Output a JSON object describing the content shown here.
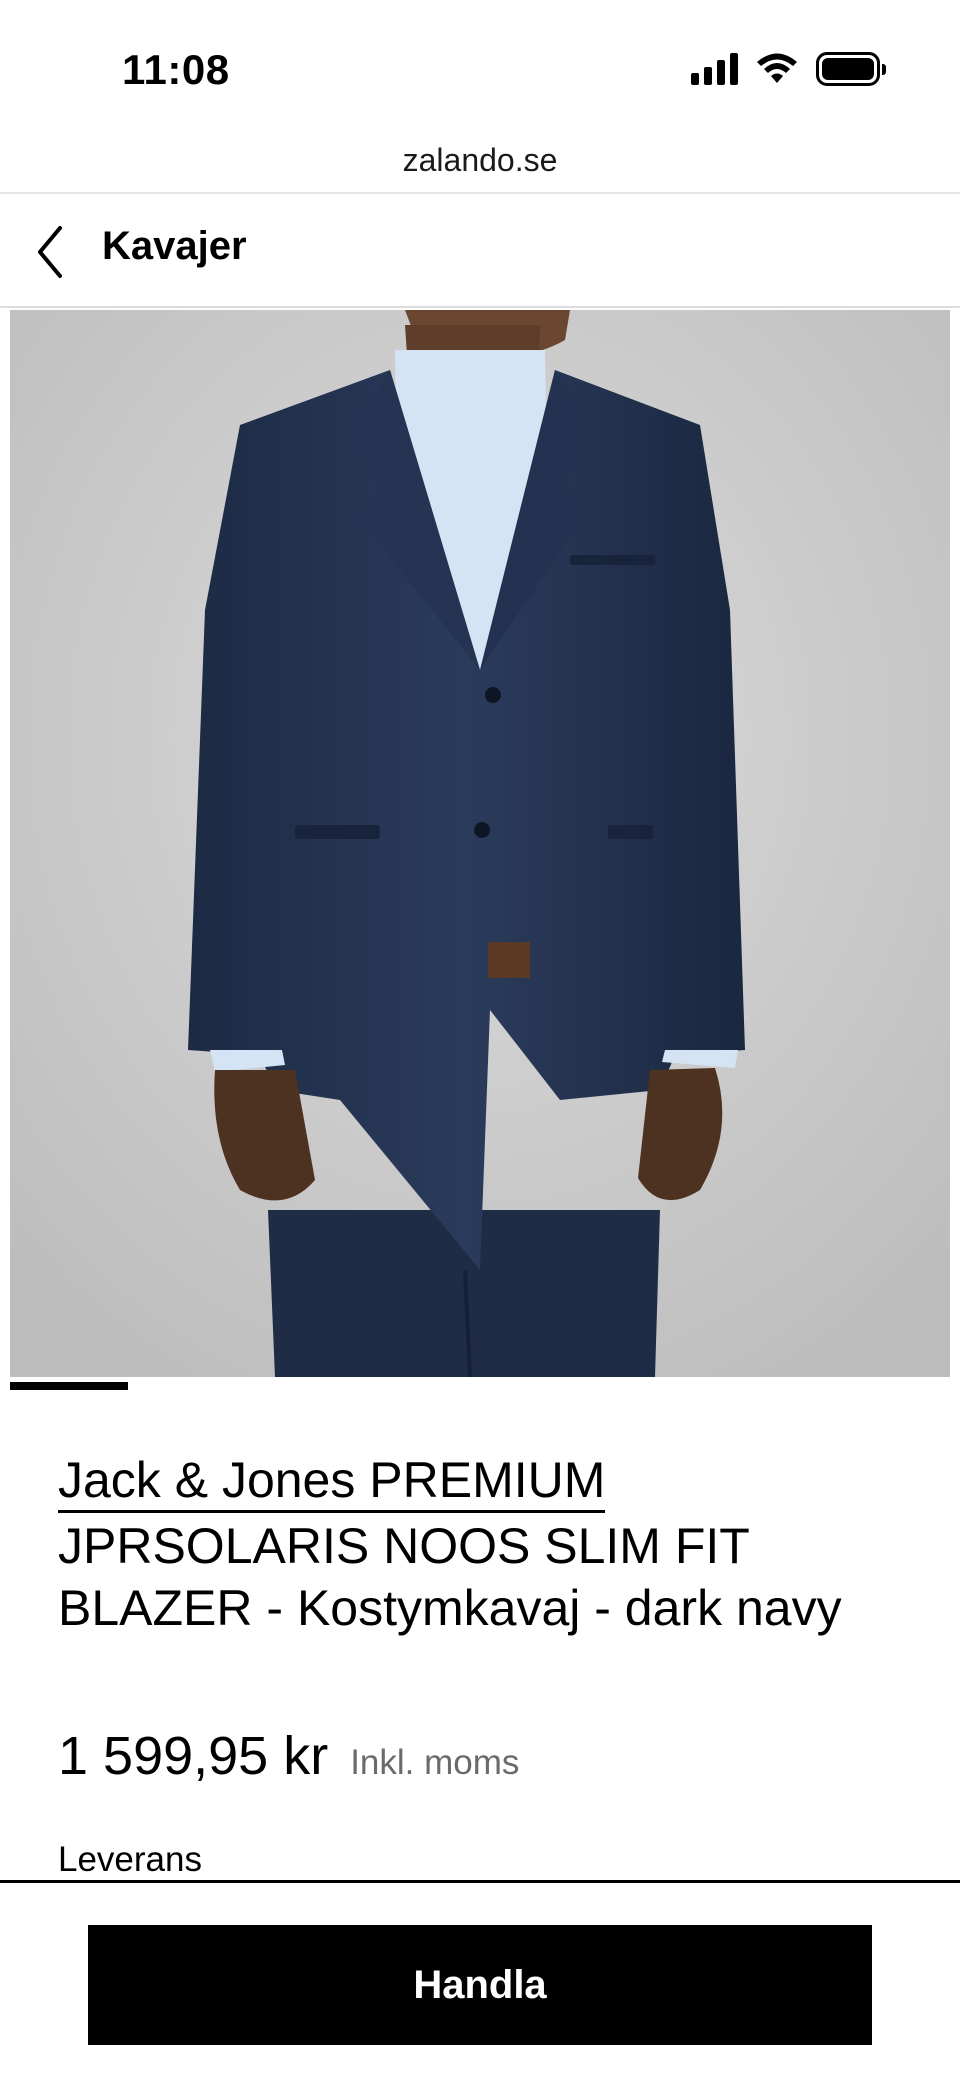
{
  "status_bar": {
    "time": "11:08"
  },
  "browser": {
    "url": "zalando.se"
  },
  "header": {
    "title": "Kavajer",
    "back_icon": "chevron-left-icon"
  },
  "product": {
    "image_alt": "Man wearing dark navy slim fit blazer",
    "gallery": {
      "current_index": 1
    },
    "brand": "Jack & Jones PREMIUM",
    "name": "JPRSOLARIS NOOS SLIM FIT BLAZER - Kostymkavaj - dark navy",
    "price": "1 599,95 kr",
    "vat_note": "Inkl. moms",
    "delivery_label": "Leverans"
  },
  "actions": {
    "buy_label": "Handla"
  },
  "colors": {
    "accent": "#000000",
    "muted_text": "#6b6b6b",
    "background": "#ffffff"
  }
}
